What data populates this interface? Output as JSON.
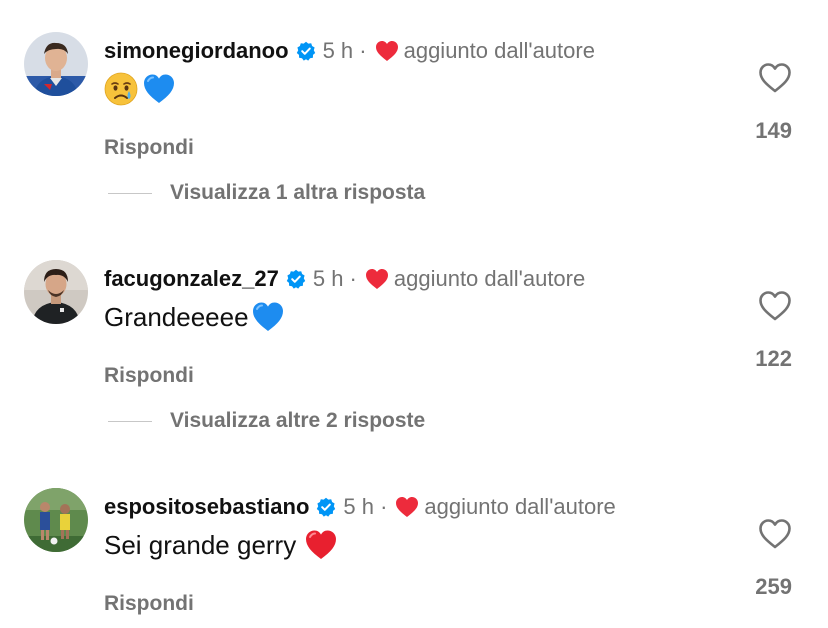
{
  "comments": [
    {
      "username": "simonegiordanoo",
      "time": "5 h ·",
      "added_label": "aggiunto dall'autore",
      "text": "",
      "emojis": [
        "crying-face",
        "blue-heart"
      ],
      "reply_label": "Rispondi",
      "likes": "149",
      "view_replies": "Visualizza 1 altra risposta"
    },
    {
      "username": "facugonzalez_27",
      "time": "5 h ·",
      "added_label": "aggiunto dall'autore",
      "text": "Grandeeeee",
      "emojis": [
        "blue-heart"
      ],
      "reply_label": "Rispondi",
      "likes": "122",
      "view_replies": "Visualizza altre 2 risposte"
    },
    {
      "username": "espositosebastiano",
      "time": "5 h ·",
      "added_label": "aggiunto dall'autore",
      "text": "Sei grande gerry",
      "emojis": [
        "red-heart"
      ],
      "reply_label": "Rispondi",
      "likes": "259"
    }
  ],
  "colors": {
    "verified": "#0095f6",
    "author_heart": "#ed2b3c",
    "secondary_text": "#737373",
    "blue_heart": "#1d8cf0"
  }
}
